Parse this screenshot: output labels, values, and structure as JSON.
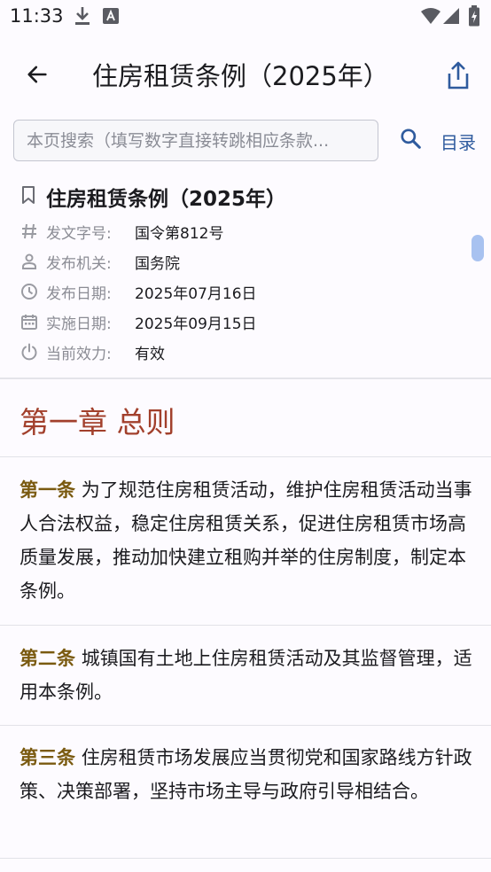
{
  "status_bar": {
    "time": "11:33"
  },
  "app_bar": {
    "title": "住房租赁条例（2025年）"
  },
  "search": {
    "placeholder": "本页搜索（填写数字直接转跳相应条款...",
    "toc_label": "目录"
  },
  "meta": {
    "title": "住房租赁条例（2025年）",
    "rows": [
      {
        "icon": "hash-icon",
        "label": "发文字号:",
        "value": "国令第812号"
      },
      {
        "icon": "person-icon",
        "label": "发布机关:",
        "value": "国务院"
      },
      {
        "icon": "clock-icon",
        "label": "发布日期:",
        "value": "2025年07月16日"
      },
      {
        "icon": "calendar-icon",
        "label": "实施日期:",
        "value": "2025年09月15日"
      },
      {
        "icon": "power-icon",
        "label": "当前效力:",
        "value": "有效"
      }
    ]
  },
  "chapter": {
    "title": "第一章 总则"
  },
  "articles": [
    {
      "number": "第一条",
      "text": "为了规范住房租赁活动，维护住房租赁活动当事人合法权益，稳定住房租赁关系，促进住房租赁市场高质量发展，推动加快建立租购并举的住房制度，制定本条例。"
    },
    {
      "number": "第二条",
      "text": "城镇国有土地上住房租赁活动及其监督管理，适用本条例。"
    },
    {
      "number": "第三条",
      "text": "住房租赁市场发展应当贯彻党和国家路线方针政策、决策部署，坚持市场主导与政府引导相结合。"
    }
  ],
  "colors": {
    "chapter": "#a2402c",
    "article_number": "#7a5a10",
    "link": "#2f5b9e"
  }
}
